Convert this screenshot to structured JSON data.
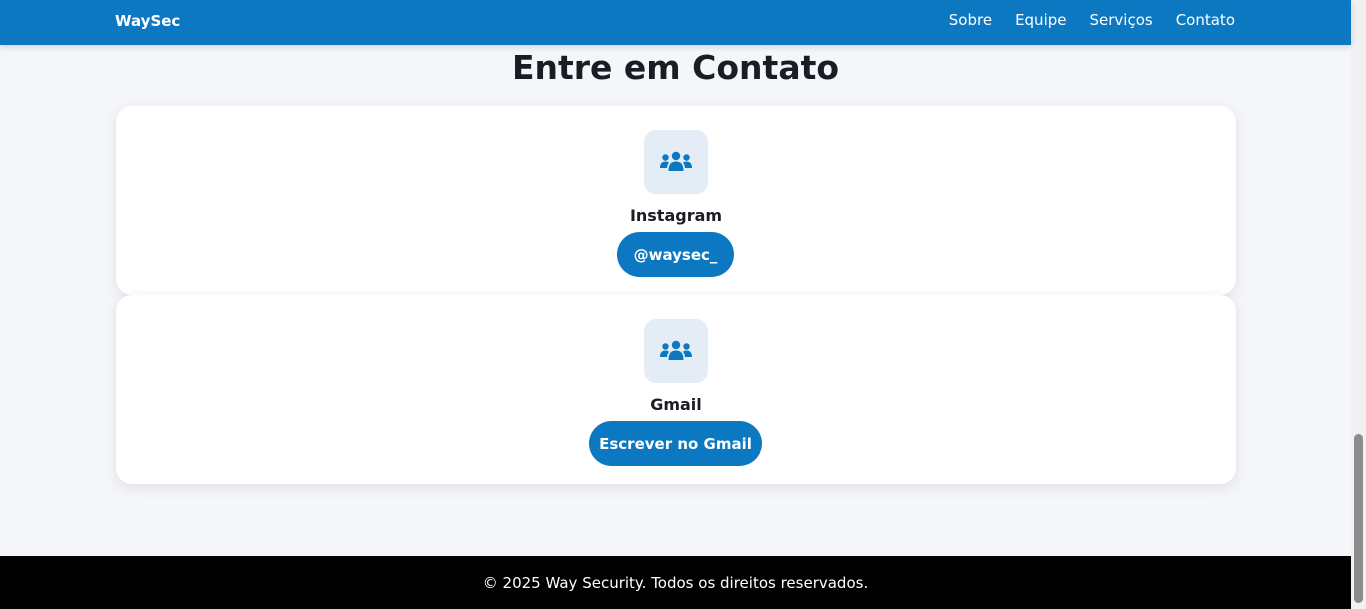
{
  "nav": {
    "brand": "WaySec",
    "links": [
      "Sobre",
      "Equipe",
      "Serviços",
      "Contato"
    ]
  },
  "section": {
    "title": "Entre em Contato"
  },
  "cards": [
    {
      "icon": "users-icon",
      "title": "Instagram",
      "button": "@waysec_"
    },
    {
      "icon": "users-icon",
      "title": "Gmail",
      "button": "Escrever no Gmail"
    }
  ],
  "footer": {
    "text": "© 2025 Way Security. Todos os direitos reservados."
  },
  "colors": {
    "primary": "#0d78c2",
    "background": "#f4f6fa",
    "icon_box": "#e4ecf6",
    "footer": "#000000"
  }
}
